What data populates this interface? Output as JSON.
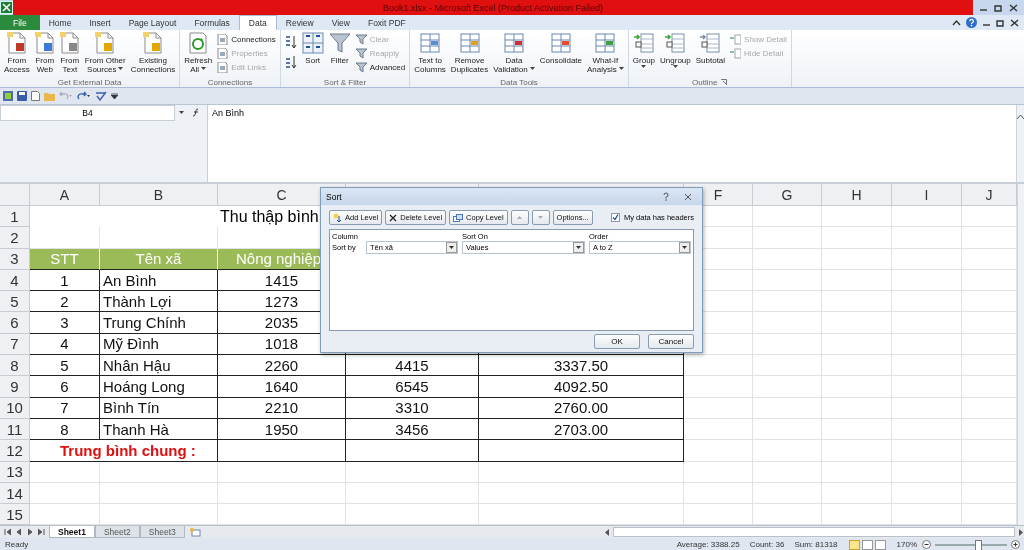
{
  "window": {
    "title": "Book1.xlsx - Microsoft Excel (Product Activation Failed)"
  },
  "ribbon": {
    "tabs": [
      {
        "label": "File",
        "kind": "file",
        "selected": false
      },
      {
        "label": "Home",
        "kind": "tab",
        "selected": false
      },
      {
        "label": "Insert",
        "kind": "tab",
        "selected": false
      },
      {
        "label": "Page Layout",
        "kind": "tab",
        "selected": false
      },
      {
        "label": "Formulas",
        "kind": "tab",
        "selected": false
      },
      {
        "label": "Data",
        "kind": "tab",
        "selected": true
      },
      {
        "label": "Review",
        "kind": "tab",
        "selected": false
      },
      {
        "label": "View",
        "kind": "tab",
        "selected": false
      },
      {
        "label": "Foxit PDF",
        "kind": "tab",
        "selected": false
      }
    ],
    "groups": [
      {
        "label": "Get External Data",
        "items": [
          {
            "kind": "large",
            "lines": [
              "From",
              "Access"
            ],
            "dropdown": false
          },
          {
            "kind": "large",
            "lines": [
              "From",
              "Web"
            ],
            "dropdown": false
          },
          {
            "kind": "large",
            "lines": [
              "From",
              "Text"
            ],
            "dropdown": false
          },
          {
            "kind": "large",
            "lines": [
              "From Other",
              "Sources"
            ],
            "dropdown": true
          },
          {
            "kind": "large",
            "lines": [
              "Existing",
              "Connections"
            ],
            "dropdown": false
          }
        ]
      },
      {
        "label": "Connections",
        "items": [
          {
            "kind": "large",
            "lines": [
              "Refresh",
              "All"
            ],
            "dropdown": true
          },
          {
            "kind": "small-stack",
            "items": [
              {
                "label": "Connections",
                "disabled": false
              },
              {
                "label": "Properties",
                "disabled": true
              },
              {
                "label": "Edit Links",
                "disabled": true
              }
            ]
          }
        ]
      },
      {
        "label": "Sort & Filter",
        "items": [
          {
            "kind": "sort-icons"
          },
          {
            "kind": "large",
            "lines": [
              "Sort"
            ],
            "dropdown": false
          },
          {
            "kind": "large",
            "lines": [
              "Filter"
            ],
            "dropdown": false
          },
          {
            "kind": "small-stack",
            "items": [
              {
                "label": "Clear",
                "disabled": true
              },
              {
                "label": "Reapply",
                "disabled": true
              },
              {
                "label": "Advanced",
                "disabled": false
              }
            ]
          }
        ]
      },
      {
        "label": "Data Tools",
        "items": [
          {
            "kind": "large",
            "lines": [
              "Text to",
              "Columns"
            ],
            "dropdown": false
          },
          {
            "kind": "large",
            "lines": [
              "Remove",
              "Duplicates"
            ],
            "dropdown": false
          },
          {
            "kind": "large",
            "lines": [
              "Data",
              "Validation"
            ],
            "dropdown": true
          },
          {
            "kind": "large",
            "lines": [
              "Consolidate"
            ],
            "dropdown": false
          },
          {
            "kind": "large",
            "lines": [
              "What-If",
              "Analysis"
            ],
            "dropdown": true
          }
        ]
      },
      {
        "label": "Outline",
        "launcher": true,
        "items": [
          {
            "kind": "large",
            "lines": [
              "Group"
            ],
            "dropdown": true
          },
          {
            "kind": "large",
            "lines": [
              "Ungroup"
            ],
            "dropdown": true
          },
          {
            "kind": "large",
            "lines": [
              "Subtotal"
            ],
            "dropdown": false
          },
          {
            "kind": "small-stack",
            "items": [
              {
                "label": "Show Detail",
                "disabled": true
              },
              {
                "label": "Hide Detail",
                "disabled": true
              }
            ]
          }
        ]
      }
    ]
  },
  "formula_bar": {
    "name_box": "B4",
    "value": "An Bình"
  },
  "sheet": {
    "columns_left": [
      "A",
      "B",
      "C"
    ],
    "columns_right": [
      "F",
      "G",
      "H",
      "I",
      "J"
    ],
    "rows": [
      {
        "kind": "title",
        "number": "1",
        "text": "Thu thập bình"
      },
      {
        "kind": "empty",
        "number": "2"
      },
      {
        "kind": "header",
        "number": "3",
        "cells": [
          "STT",
          "Tên xã",
          "Nông nghiệp"
        ]
      },
      {
        "kind": "data",
        "number": "4",
        "cells": [
          "1",
          "An Bình",
          "1415"
        ]
      },
      {
        "kind": "data",
        "number": "5",
        "cells": [
          "2",
          "Thành Lợi",
          "1273"
        ]
      },
      {
        "kind": "data",
        "number": "6",
        "cells": [
          "3",
          "Trung Chính",
          "2035"
        ]
      },
      {
        "kind": "data",
        "number": "7",
        "cells": [
          "4",
          "Mỹ Đình",
          "1018"
        ]
      },
      {
        "kind": "data",
        "number": "8",
        "cells": [
          "5",
          "Nhân Hậu",
          "2260",
          "4415",
          "3337.50"
        ]
      },
      {
        "kind": "data",
        "number": "9",
        "cells": [
          "6",
          "Hoáng Long",
          "1640",
          "6545",
          "4092.50"
        ]
      },
      {
        "kind": "data",
        "number": "10",
        "cells": [
          "7",
          "Bình Tín",
          "2210",
          "3310",
          "2760.00"
        ]
      },
      {
        "kind": "data",
        "number": "11",
        "cells": [
          "8",
          "Thanh Hà",
          "1950",
          "3456",
          "2703.00"
        ]
      },
      {
        "kind": "summary",
        "number": "12",
        "text": "Trung bình chung :"
      },
      {
        "kind": "empty",
        "number": "13"
      },
      {
        "kind": "empty",
        "number": "14"
      },
      {
        "kind": "empty",
        "number": "15"
      }
    ]
  },
  "sort_dialog": {
    "title": "Sort",
    "toolbar": [
      {
        "label": "Add Level",
        "kind": "add"
      },
      {
        "label": "Delete Level",
        "kind": "delete"
      },
      {
        "label": "Copy Level",
        "kind": "copy"
      }
    ],
    "move_up": {
      "disabled": true
    },
    "move_down": {
      "disabled": true
    },
    "options_button": "Options...",
    "headers_checkbox": {
      "label": "My data has headers",
      "checked": true
    },
    "columns": [
      "Column",
      "Sort On",
      "Order"
    ],
    "levels": [
      {
        "label": "Sort by",
        "column": "Tên xã",
        "sort_on": "Values",
        "order": "A to Z"
      }
    ],
    "buttons": [
      "OK",
      "Cancel"
    ]
  },
  "sheet_tabs": [
    {
      "label": "Sheet1",
      "selected": true
    },
    {
      "label": "Sheet2",
      "selected": false
    },
    {
      "label": "Sheet3",
      "selected": false
    }
  ],
  "status_bar": {
    "mode": "Ready",
    "average": "Average: 3388.25",
    "count": "Count: 36",
    "sum": "Sum: 81318",
    "zoom": "170%",
    "zoom_slider": {
      "level": 0.6
    }
  }
}
